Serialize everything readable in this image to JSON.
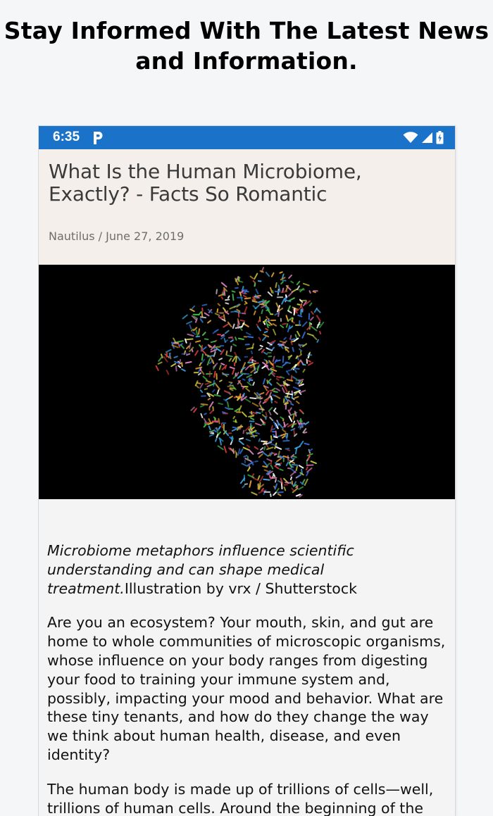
{
  "promo": {
    "heading": "Stay Informed With The Latest News and Information."
  },
  "status_bar": {
    "time": "6:35",
    "app_icon": "p-icon",
    "background": "#1a73c9"
  },
  "article": {
    "title": "What Is the Human Microbiome, Exactly? - Facts So Romantic",
    "meta": "Nautilus / June 27, 2019",
    "hero_image": "microbiome-head-illustration",
    "caption_italic": "Microbiome metaphors influence scientific understanding and can shape medical treatment.",
    "caption_credit": "Illustration by vrx / Shutterstock",
    "paragraphs": [
      "Are you an ecosystem? Your mouth, skin, and gut are home to whole communities of microscopic organisms, whose influence on your body ranges from digesting your food to training your immune system and, possibly, impacting your mood and behavior. What are these tiny tenants, and how do they change the way we think about human health, disease, and even identity?",
      "The human body is made up of trillions of cells—well, trillions of human cells. Around the beginning of the"
    ]
  }
}
